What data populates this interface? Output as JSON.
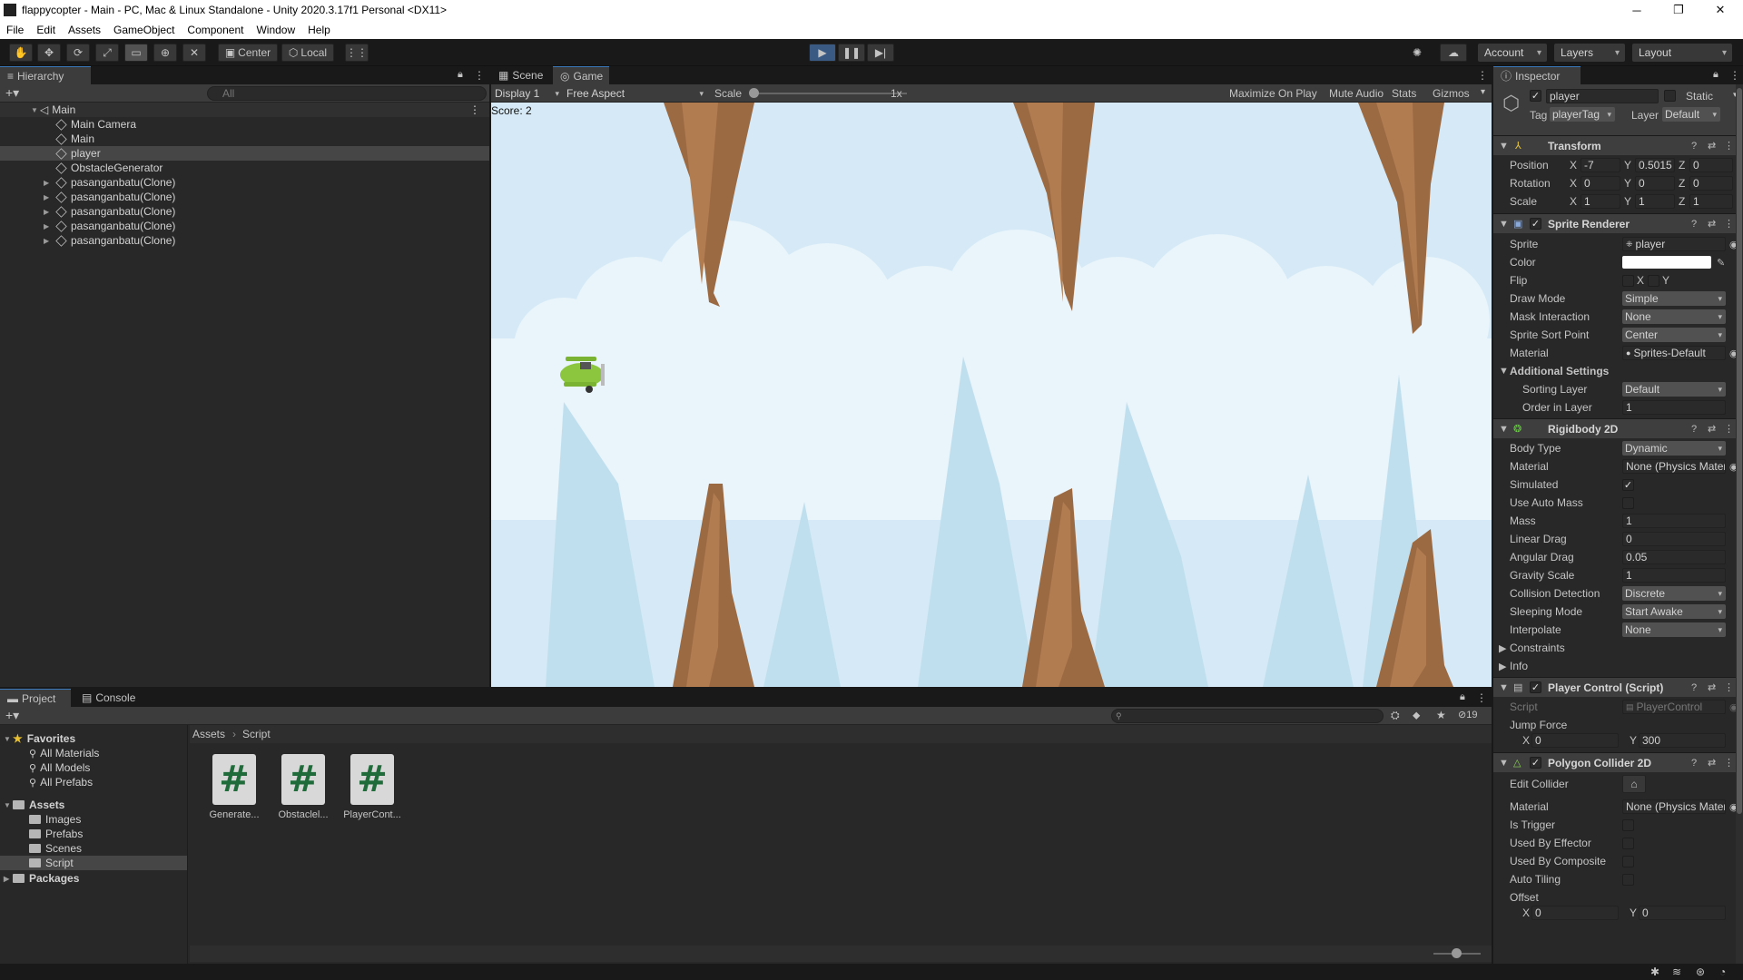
{
  "window": {
    "title": "flappycopter - Main - PC, Mac & Linux Standalone - Unity 2020.3.17f1 Personal <DX11>"
  },
  "menu": [
    "File",
    "Edit",
    "Assets",
    "GameObject",
    "Component",
    "Window",
    "Help"
  ],
  "toolbar": {
    "pivot": "Center",
    "space": "Local",
    "account": "Account",
    "layers": "Layers",
    "layout": "Layout"
  },
  "hierarchy": {
    "title": "Hierarchy",
    "search_placeholder": "All",
    "scene": "Main",
    "items": [
      "Main Camera",
      "Main",
      "player",
      "ObstacleGenerator",
      "pasanganbatu(Clone)",
      "pasanganbatu(Clone)",
      "pasanganbatu(Clone)",
      "pasanganbatu(Clone)",
      "pasanganbatu(Clone)"
    ]
  },
  "scene_tabs": {
    "scene": "Scene",
    "game": "Game"
  },
  "game_bar": {
    "display": "Display 1",
    "aspect": "Free Aspect",
    "scale_label": "Scale",
    "scale_value": "1x",
    "maximize": "Maximize On Play",
    "mute": "Mute Audio",
    "stats": "Stats",
    "gizmos": "Gizmos"
  },
  "game": {
    "score": "Score: 2"
  },
  "inspector": {
    "title": "Inspector",
    "name": "player",
    "static": "Static",
    "tag_label": "Tag",
    "tag": "playerTag",
    "layer_label": "Layer",
    "layer": "Default",
    "transform": {
      "title": "Transform",
      "position_label": "Position",
      "pos_x": "-7",
      "pos_y": "0.5015",
      "pos_z": "0",
      "rotation_label": "Rotation",
      "rot_x": "0",
      "rot_y": "0",
      "rot_z": "0",
      "scale_label": "Scale",
      "scl_x": "1",
      "scl_y": "1",
      "scl_z": "1"
    },
    "sprite_renderer": {
      "title": "Sprite Renderer",
      "sprite_label": "Sprite",
      "sprite": "player",
      "color_label": "Color",
      "flip_label": "Flip",
      "flip_x": "X",
      "flip_y": "Y",
      "draw_mode_label": "Draw Mode",
      "draw_mode": "Simple",
      "mask_label": "Mask Interaction",
      "mask": "None",
      "sort_point_label": "Sprite Sort Point",
      "sort_point": "Center",
      "material_label": "Material",
      "material": "Sprites-Default",
      "additional": "Additional Settings",
      "sorting_layer_label": "Sorting Layer",
      "sorting_layer": "Default",
      "order_label": "Order in Layer",
      "order": "1"
    },
    "rigidbody": {
      "title": "Rigidbody 2D",
      "body_type_label": "Body Type",
      "body_type": "Dynamic",
      "material_label": "Material",
      "material": "None (Physics Material 2D)",
      "simulated_label": "Simulated",
      "auto_mass_label": "Use Auto Mass",
      "mass_label": "Mass",
      "mass": "1",
      "linear_drag_label": "Linear Drag",
      "linear_drag": "0",
      "angular_drag_label": "Angular Drag",
      "angular_drag": "0.05",
      "gravity_label": "Gravity Scale",
      "gravity": "1",
      "collision_label": "Collision Detection",
      "collision": "Discrete",
      "sleeping_label": "Sleeping Mode",
      "sleeping": "Start Awake",
      "interpolate_label": "Interpolate",
      "interpolate": "None",
      "constraints": "Constraints",
      "info": "Info"
    },
    "player_control": {
      "title": "Player Control (Script)",
      "script_label": "Script",
      "script": "PlayerControl",
      "jump_label": "Jump Force",
      "jump_x": "0",
      "jump_y": "300"
    },
    "polygon": {
      "title": "Polygon Collider 2D",
      "edit_label": "Edit Collider",
      "material_label": "Material",
      "material": "None (Physics Material 2D)",
      "trigger_label": "Is Trigger",
      "effector_label": "Used By Effector",
      "composite_label": "Used By Composite",
      "tiling_label": "Auto Tiling",
      "offset_label": "Offset",
      "off_x": "0",
      "off_y": "0"
    }
  },
  "project": {
    "tab_project": "Project",
    "tab_console": "Console",
    "count": "19",
    "favorites": "Favorites",
    "fav_items": [
      "All Materials",
      "All Models",
      "All Prefabs"
    ],
    "assets": "Assets",
    "folders": [
      "Images",
      "Prefabs",
      "Scenes",
      "Script"
    ],
    "packages": "Packages",
    "breadcrumb_root": "Assets",
    "breadcrumb_current": "Script",
    "files": [
      "Generate...",
      "Obstaclel...",
      "PlayerCont..."
    ]
  }
}
